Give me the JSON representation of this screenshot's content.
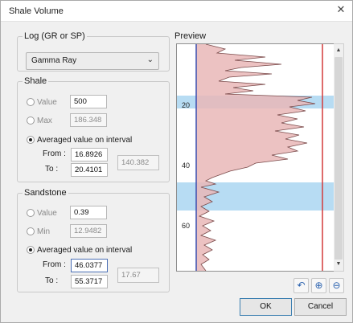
{
  "window": {
    "title": "Shale Volume",
    "close_icon": "close-icon"
  },
  "log_group": {
    "legend": "Log (GR or SP)",
    "selected": "Gamma Ray"
  },
  "shale": {
    "legend": "Shale",
    "value_label": "Value",
    "value": "500",
    "max_label": "Max",
    "max": "186.348",
    "avg_label": "Averaged value on interval",
    "from_label": "From :",
    "from": "16.8926",
    "to_label": "To :",
    "to": "20.4101",
    "avg_result": "140.382"
  },
  "sandstone": {
    "legend": "Sandstone",
    "value_label": "Value",
    "value": "0.39",
    "min_label": "Min",
    "min": "12.9482",
    "avg_label": "Averaged value on interval",
    "from_label": "From :",
    "from": "46.0377",
    "to_label": "To :",
    "to": "55.3717",
    "avg_result": "17.67"
  },
  "preview": {
    "legend": "Preview",
    "depth_labels": [
      "20",
      "40",
      "60"
    ],
    "colors": {
      "log_fill": "#e9b7b7",
      "log_line": "#7a4a4a",
      "shale_line": "#d43a3a",
      "sand_line": "#3a4fb0",
      "interval": "#9fd0ef"
    },
    "toolbar_icons": [
      "undo-icon",
      "zoom-in-icon",
      "zoom-out-icon"
    ]
  },
  "buttons": {
    "ok": "OK",
    "cancel": "Cancel"
  }
}
